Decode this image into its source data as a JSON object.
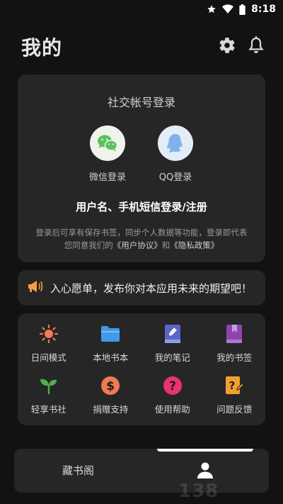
{
  "status_bar": {
    "time": "8:18",
    "icons": [
      "star-icon",
      "wifi-icon",
      "battery-icon"
    ]
  },
  "header": {
    "title": "我的",
    "icons": [
      "gear-icon",
      "bell-icon"
    ]
  },
  "login": {
    "title": "社交帐号登录",
    "wechat_label": "微信登录",
    "qq_label": "QQ登录",
    "phone_login": "用户名、手机短信登录/注册",
    "notice_line1": "登录后可享有保存书签，同步个人数据等功能，登录即代表",
    "notice_prefix": "您同意我们的",
    "user_agreement": "《用户协议》",
    "and": "和",
    "privacy_policy": "《隐私政策》"
  },
  "wish": {
    "text": "入心愿单，发布你对本应用未来的期望吧！",
    "icon": "megaphone-icon",
    "accent": "#f5a043"
  },
  "features": {
    "items": [
      {
        "label": "日间模式",
        "icon": "sun-icon",
        "color": "#f07a54"
      },
      {
        "label": "本地书本",
        "icon": "folder-icon",
        "color": "#3f9be8"
      },
      {
        "label": "我的笔记",
        "icon": "notebook-icon",
        "color": "#5b64c8"
      },
      {
        "label": "我的书签",
        "icon": "bookmark-icon",
        "color": "#8e44ad"
      },
      {
        "label": "轻享书社",
        "icon": "sprout-icon",
        "color": "#4caf50"
      },
      {
        "label": "捐赠支持",
        "icon": "dollar-icon",
        "color": "#f07a54"
      },
      {
        "label": "使用帮助",
        "icon": "help-icon",
        "color": "#e8336d"
      },
      {
        "label": "问题反馈",
        "icon": "feedback-icon",
        "color": "#f0a030"
      }
    ]
  },
  "bottom_nav": {
    "tabs": [
      {
        "label": "藏书阁"
      },
      {
        "icon": "user-icon",
        "active": true
      }
    ]
  },
  "watermark": "138"
}
